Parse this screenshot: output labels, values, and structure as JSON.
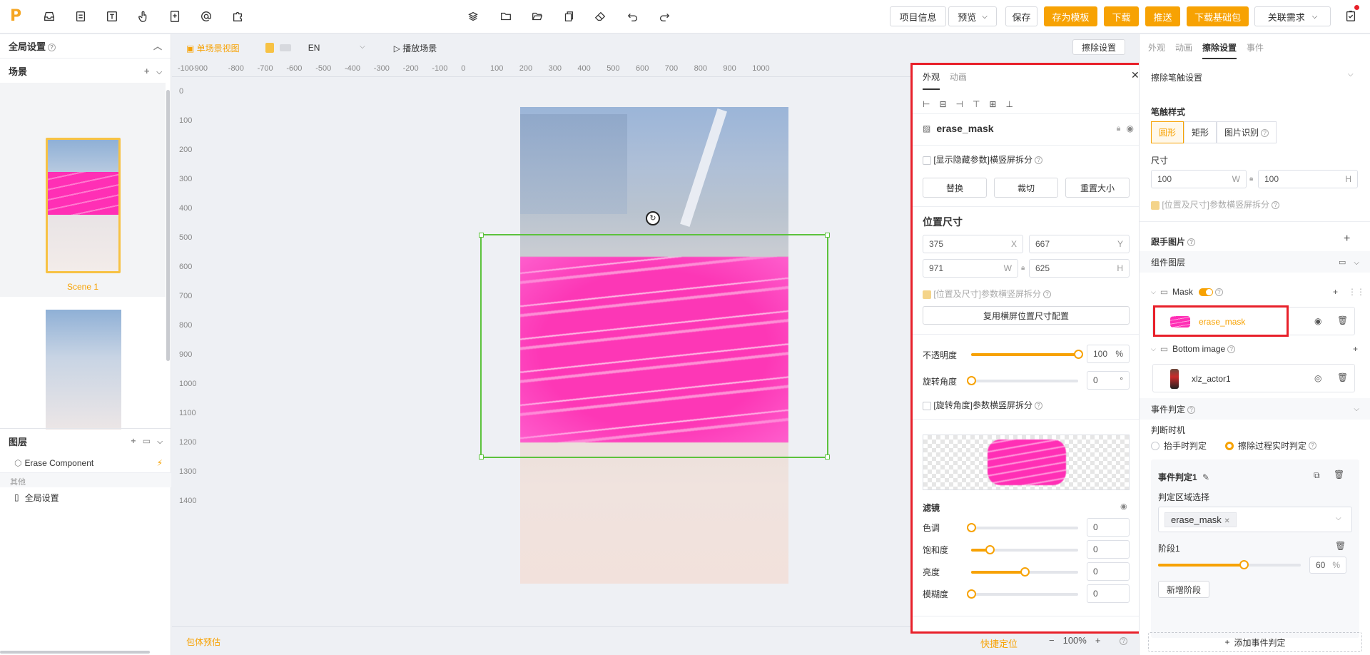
{
  "topbar": {
    "logo": "P",
    "tool_icons": [
      "inbox-icon",
      "document-icon",
      "text-icon",
      "hand-icon",
      "file-icon",
      "at-icon",
      "puzzle-icon"
    ],
    "center_icons": [
      "layers-icon",
      "folder-icon",
      "folder-open-icon",
      "copy-icon",
      "clear-icon",
      "undo-icon",
      "redo-icon"
    ],
    "btn_project_info": "项目信息",
    "btn_preview": "预览",
    "btn_save": "保存",
    "btn_save_template": "存为模板",
    "btn_download": "下载",
    "btn_push": "推送",
    "btn_download_base": "下载基础包",
    "btn_related": "关联需求"
  },
  "left": {
    "global_settings": "全局设置",
    "scenes_title": "场景",
    "scene1_label": "Scene 1",
    "layers_title": "图层",
    "erase_component": "Erase Component",
    "other_label": "其他",
    "global_item": "全局设置"
  },
  "canvas_toolbar": {
    "single_view": "单场景视图",
    "language": "EN",
    "play_scene": "播放场景",
    "erase_settings": "擦除设置"
  },
  "rulers": {
    "h": [
      "-100",
      "-900",
      "-800",
      "-700",
      "-600",
      "-500",
      "-400",
      "-300",
      "-200",
      "-100",
      "0",
      "100",
      "200",
      "300",
      "400",
      "500",
      "600",
      "700",
      "800",
      "900",
      "1000"
    ],
    "v": [
      "0",
      "100",
      "200",
      "300",
      "400",
      "500",
      "600",
      "700",
      "800",
      "900",
      "1000",
      "1100",
      "1200",
      "1300",
      "1400"
    ]
  },
  "bottom": {
    "size_estimate": "包体预估",
    "quick_locate": "快捷定位",
    "zoom_minus": "−",
    "zoom": "100%",
    "zoom_plus": "+"
  },
  "inspector": {
    "tab_appearance": "外观",
    "tab_animation": "动画",
    "name": "erase_mask",
    "show_hidden": "[显示隐藏参数]横竖屏拆分",
    "btn_replace": "替换",
    "btn_crop": "裁切",
    "btn_reset_size": "重置大小",
    "pos_title": "位置尺寸",
    "x": "375",
    "x_unit": "X",
    "y": "667",
    "y_unit": "Y",
    "w": "971",
    "w_unit": "W",
    "h": "625",
    "h_unit": "H",
    "pos_split": "[位置及尺寸]参数横竖屏拆分",
    "reuse_btn": "复用横屏位置尺寸配置",
    "opacity_label": "不透明度",
    "opacity_value": "100",
    "opacity_unit": "%",
    "opacity_level": 1.0,
    "rotation_label": "旋转角度",
    "rotation_value": "0",
    "rotation_unit": "°",
    "rotation_level": 0.0,
    "rotation_split": "[旋转角度]参数横竖屏拆分",
    "filter_title": "滤镜",
    "hue_label": "色调",
    "hue_value": "0",
    "hue_level": 0.0,
    "saturation_label": "饱和度",
    "saturation_value": "0",
    "saturation_level": 0.17,
    "brightness_label": "亮度",
    "brightness_value": "0",
    "brightness_level": 0.5,
    "blur_label": "模糊度",
    "blur_value": "0",
    "blur_level": 0.0
  },
  "right": {
    "tab_appearance": "外观",
    "tab_animation": "动画",
    "tab_erase": "擦除设置",
    "tab_event": "事件",
    "brush_settings": "擦除笔触设置",
    "brush_style": "笔触样式",
    "style_circle": "圆形",
    "style_rect": "矩形",
    "style_image": "图片识别",
    "size_label": "尺寸",
    "size_w": "100",
    "size_w_unit": "W",
    "size_h": "100",
    "size_h_unit": "H",
    "size_split": "[位置及尺寸]参数横竖屏拆分",
    "hand_image": "跟手图片",
    "component_layers": "组件图层",
    "mask_group": "Mask",
    "mask_item": "erase_mask",
    "bottom_group": "Bottom image",
    "bottom_item": "xlz_actor1",
    "event_judgement": "事件判定",
    "judge_timing": "判断时机",
    "timing_release": "抬手时判定",
    "timing_realtime": "擦除过程实时判定",
    "event1_title": "事件判定1",
    "region_select": "判定区域选择",
    "region_tag": "erase_mask",
    "stage1": "阶段1",
    "stage_value": "60",
    "stage_unit": "%",
    "stage_level": 0.6,
    "add_stage": "新增阶段",
    "add_event": "添加事件判定"
  },
  "colors": {
    "accent": "#f7a203",
    "highlight": "#e8202a",
    "selection": "#5cc23c",
    "pink": "#ff2fb5"
  }
}
